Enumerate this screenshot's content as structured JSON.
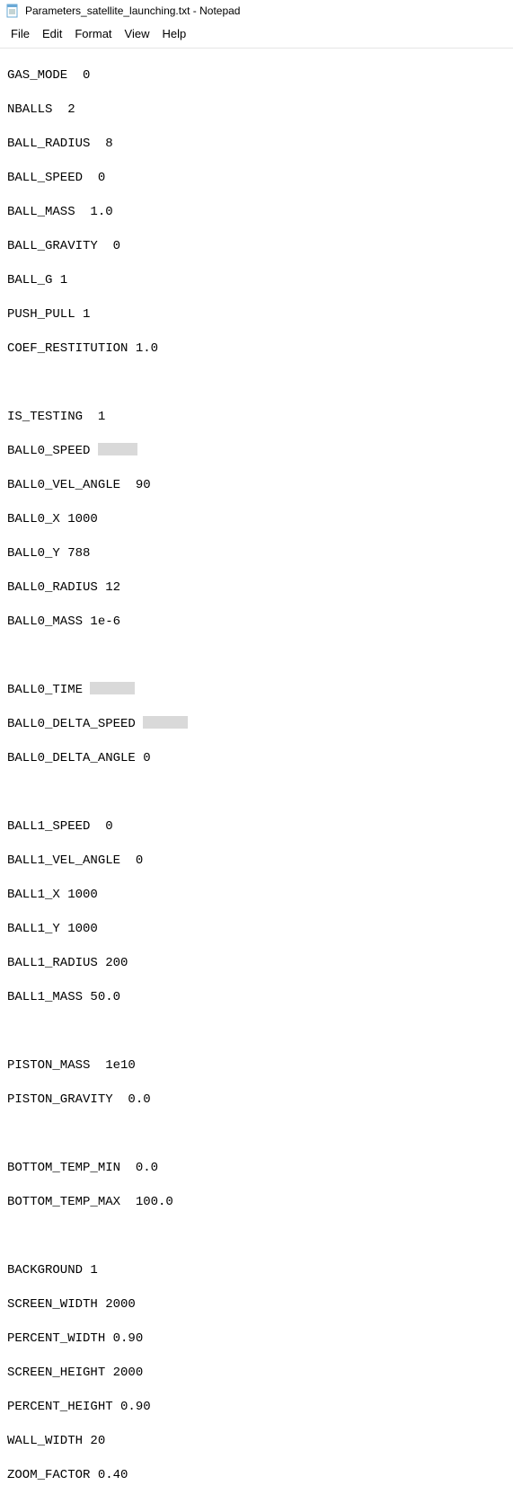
{
  "window": {
    "title": "Parameters_satellite_launching.txt - Notepad"
  },
  "menu": {
    "file": "File",
    "edit": "Edit",
    "format": "Format",
    "view": "View",
    "help": "Help"
  },
  "lines": {
    "l0": "GAS_MODE  0",
    "l1": "NBALLS  2",
    "l2": "BALL_RADIUS  8",
    "l3": "BALL_SPEED  0",
    "l4": "BALL_MASS  1.0",
    "l5": "BALL_GRAVITY  0",
    "l6": "BALL_G 1",
    "l7": "PUSH_PULL 1",
    "l8": "COEF_RESTITUTION 1.0",
    "l9": "IS_TESTING  1",
    "l10": "BALL0_SPEED ",
    "l11": "BALL0_VEL_ANGLE  90",
    "l12": "BALL0_X 1000",
    "l13": "BALL0_Y 788",
    "l14": "BALL0_RADIUS 12",
    "l15": "BALL0_MASS 1e-6",
    "l16": "BALL0_TIME ",
    "l17": "BALL0_DELTA_SPEED ",
    "l18": "BALL0_DELTA_ANGLE 0",
    "l19": "BALL1_SPEED  0",
    "l20": "BALL1_VEL_ANGLE  0",
    "l21": "BALL1_X 1000",
    "l22": "BALL1_Y 1000",
    "l23": "BALL1_RADIUS 200",
    "l24": "BALL1_MASS 50.0",
    "l25": "PISTON_MASS  1e10",
    "l26": "PISTON_GRAVITY  0.0",
    "l27": "BOTTOM_TEMP_MIN  0.0",
    "l28": "BOTTOM_TEMP_MAX  100.0",
    "l29": "BACKGROUND 1",
    "l30": "SCREEN_WIDTH 2000",
    "l31": "PERCENT_WIDTH 0.90",
    "l32": "SCREEN_HEIGHT 2000",
    "l33": "PERCENT_HEIGHT 0.90",
    "l34": "WALL_WIDTH 20",
    "l35": "ZOOM_FACTOR 0.40"
  }
}
